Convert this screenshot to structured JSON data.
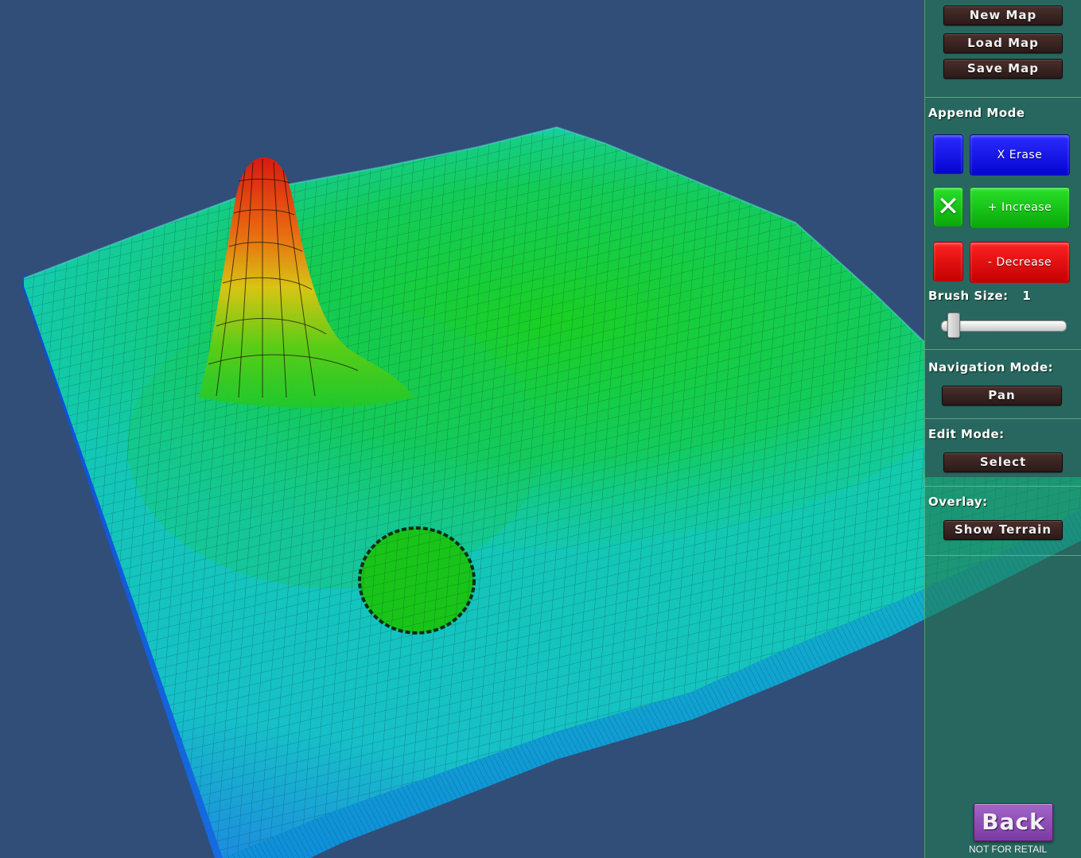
{
  "panel": {
    "file_buttons": {
      "new_map": "New Map",
      "load_map": "Load Map",
      "save_map": "Save Map"
    },
    "append_mode": {
      "label": "Append Mode",
      "erase_label": "X Erase",
      "increase_label": "+ Increase",
      "decrease_label": "- Decrease",
      "selected": "increase",
      "checkmark": "✕"
    },
    "brush": {
      "label": "Brush Size:",
      "value": "1"
    },
    "navigation": {
      "label": "Navigation Mode:",
      "value": "Pan"
    },
    "edit": {
      "label": "Edit Mode:",
      "value": "Select"
    },
    "overlay": {
      "label": "Overlay:",
      "value": "Show Terrain"
    }
  },
  "back_button": "Back",
  "footer_note": "NOT FOR RETAIL",
  "colors": {
    "background": "#304e78",
    "panel": "#227850",
    "erase": "#0a0ae6",
    "increase": "#14c814",
    "decrease": "#e60a0a",
    "back": "#8e4fb6"
  },
  "icons": {
    "increase_selected": "check-x-icon"
  }
}
